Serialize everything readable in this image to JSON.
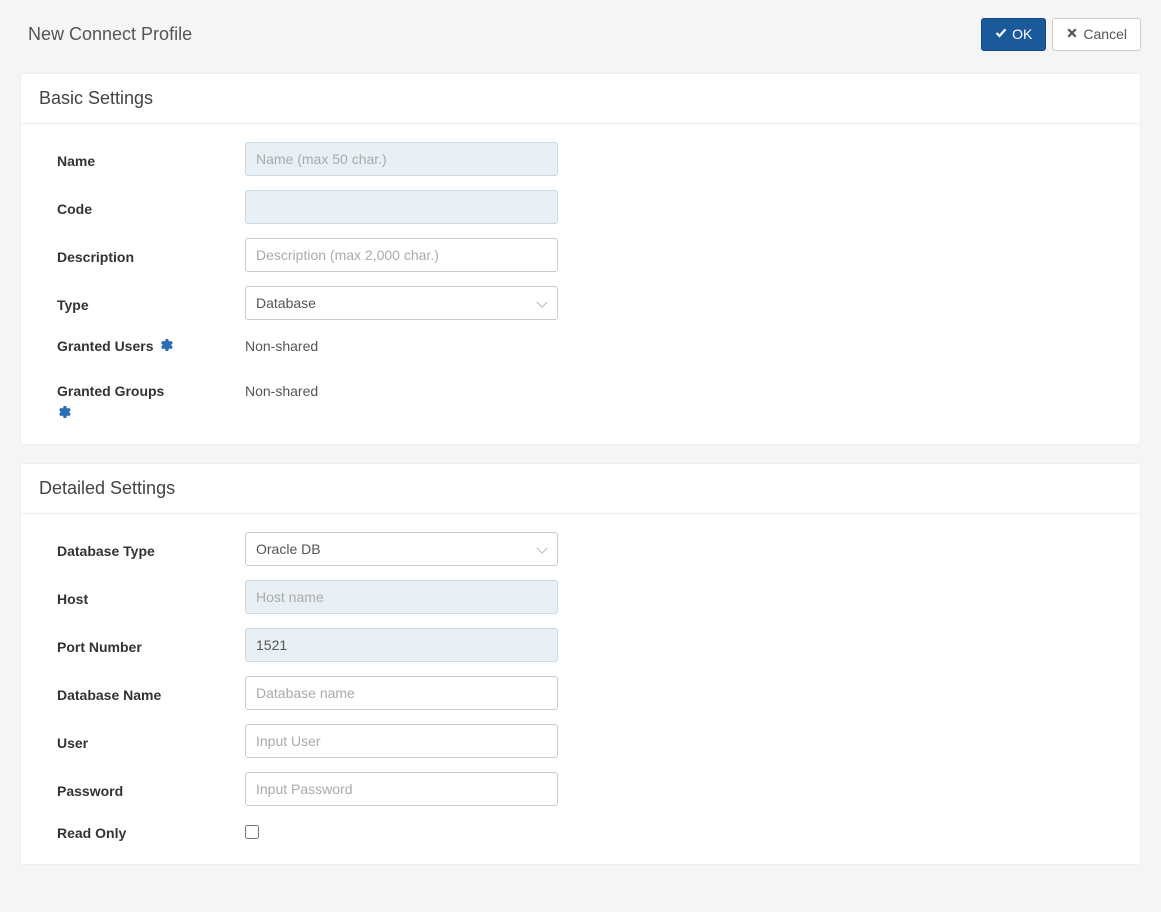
{
  "header": {
    "title": "New Connect Profile",
    "ok_label": "OK",
    "cancel_label": "Cancel"
  },
  "basic": {
    "panel_title": "Basic Settings",
    "name_label": "Name",
    "name_placeholder": "Name (max 50 char.)",
    "name_value": "",
    "code_label": "Code",
    "code_value": "",
    "description_label": "Description",
    "description_placeholder": "Description (max 2,000 char.)",
    "description_value": "",
    "type_label": "Type",
    "type_value": "Database",
    "granted_users_label": "Granted Users",
    "granted_users_value": "Non-shared",
    "granted_groups_label": "Granted Groups",
    "granted_groups_value": "Non-shared"
  },
  "detailed": {
    "panel_title": "Detailed Settings",
    "db_type_label": "Database Type",
    "db_type_value": "Oracle DB",
    "host_label": "Host",
    "host_placeholder": "Host name",
    "host_value": "",
    "port_label": "Port Number",
    "port_value": "1521",
    "dbname_label": "Database Name",
    "dbname_placeholder": "Database name",
    "dbname_value": "",
    "user_label": "User",
    "user_placeholder": "Input User",
    "user_value": "",
    "password_label": "Password",
    "password_placeholder": "Input Password",
    "password_value": "",
    "readonly_label": "Read Only",
    "readonly_checked": false
  }
}
